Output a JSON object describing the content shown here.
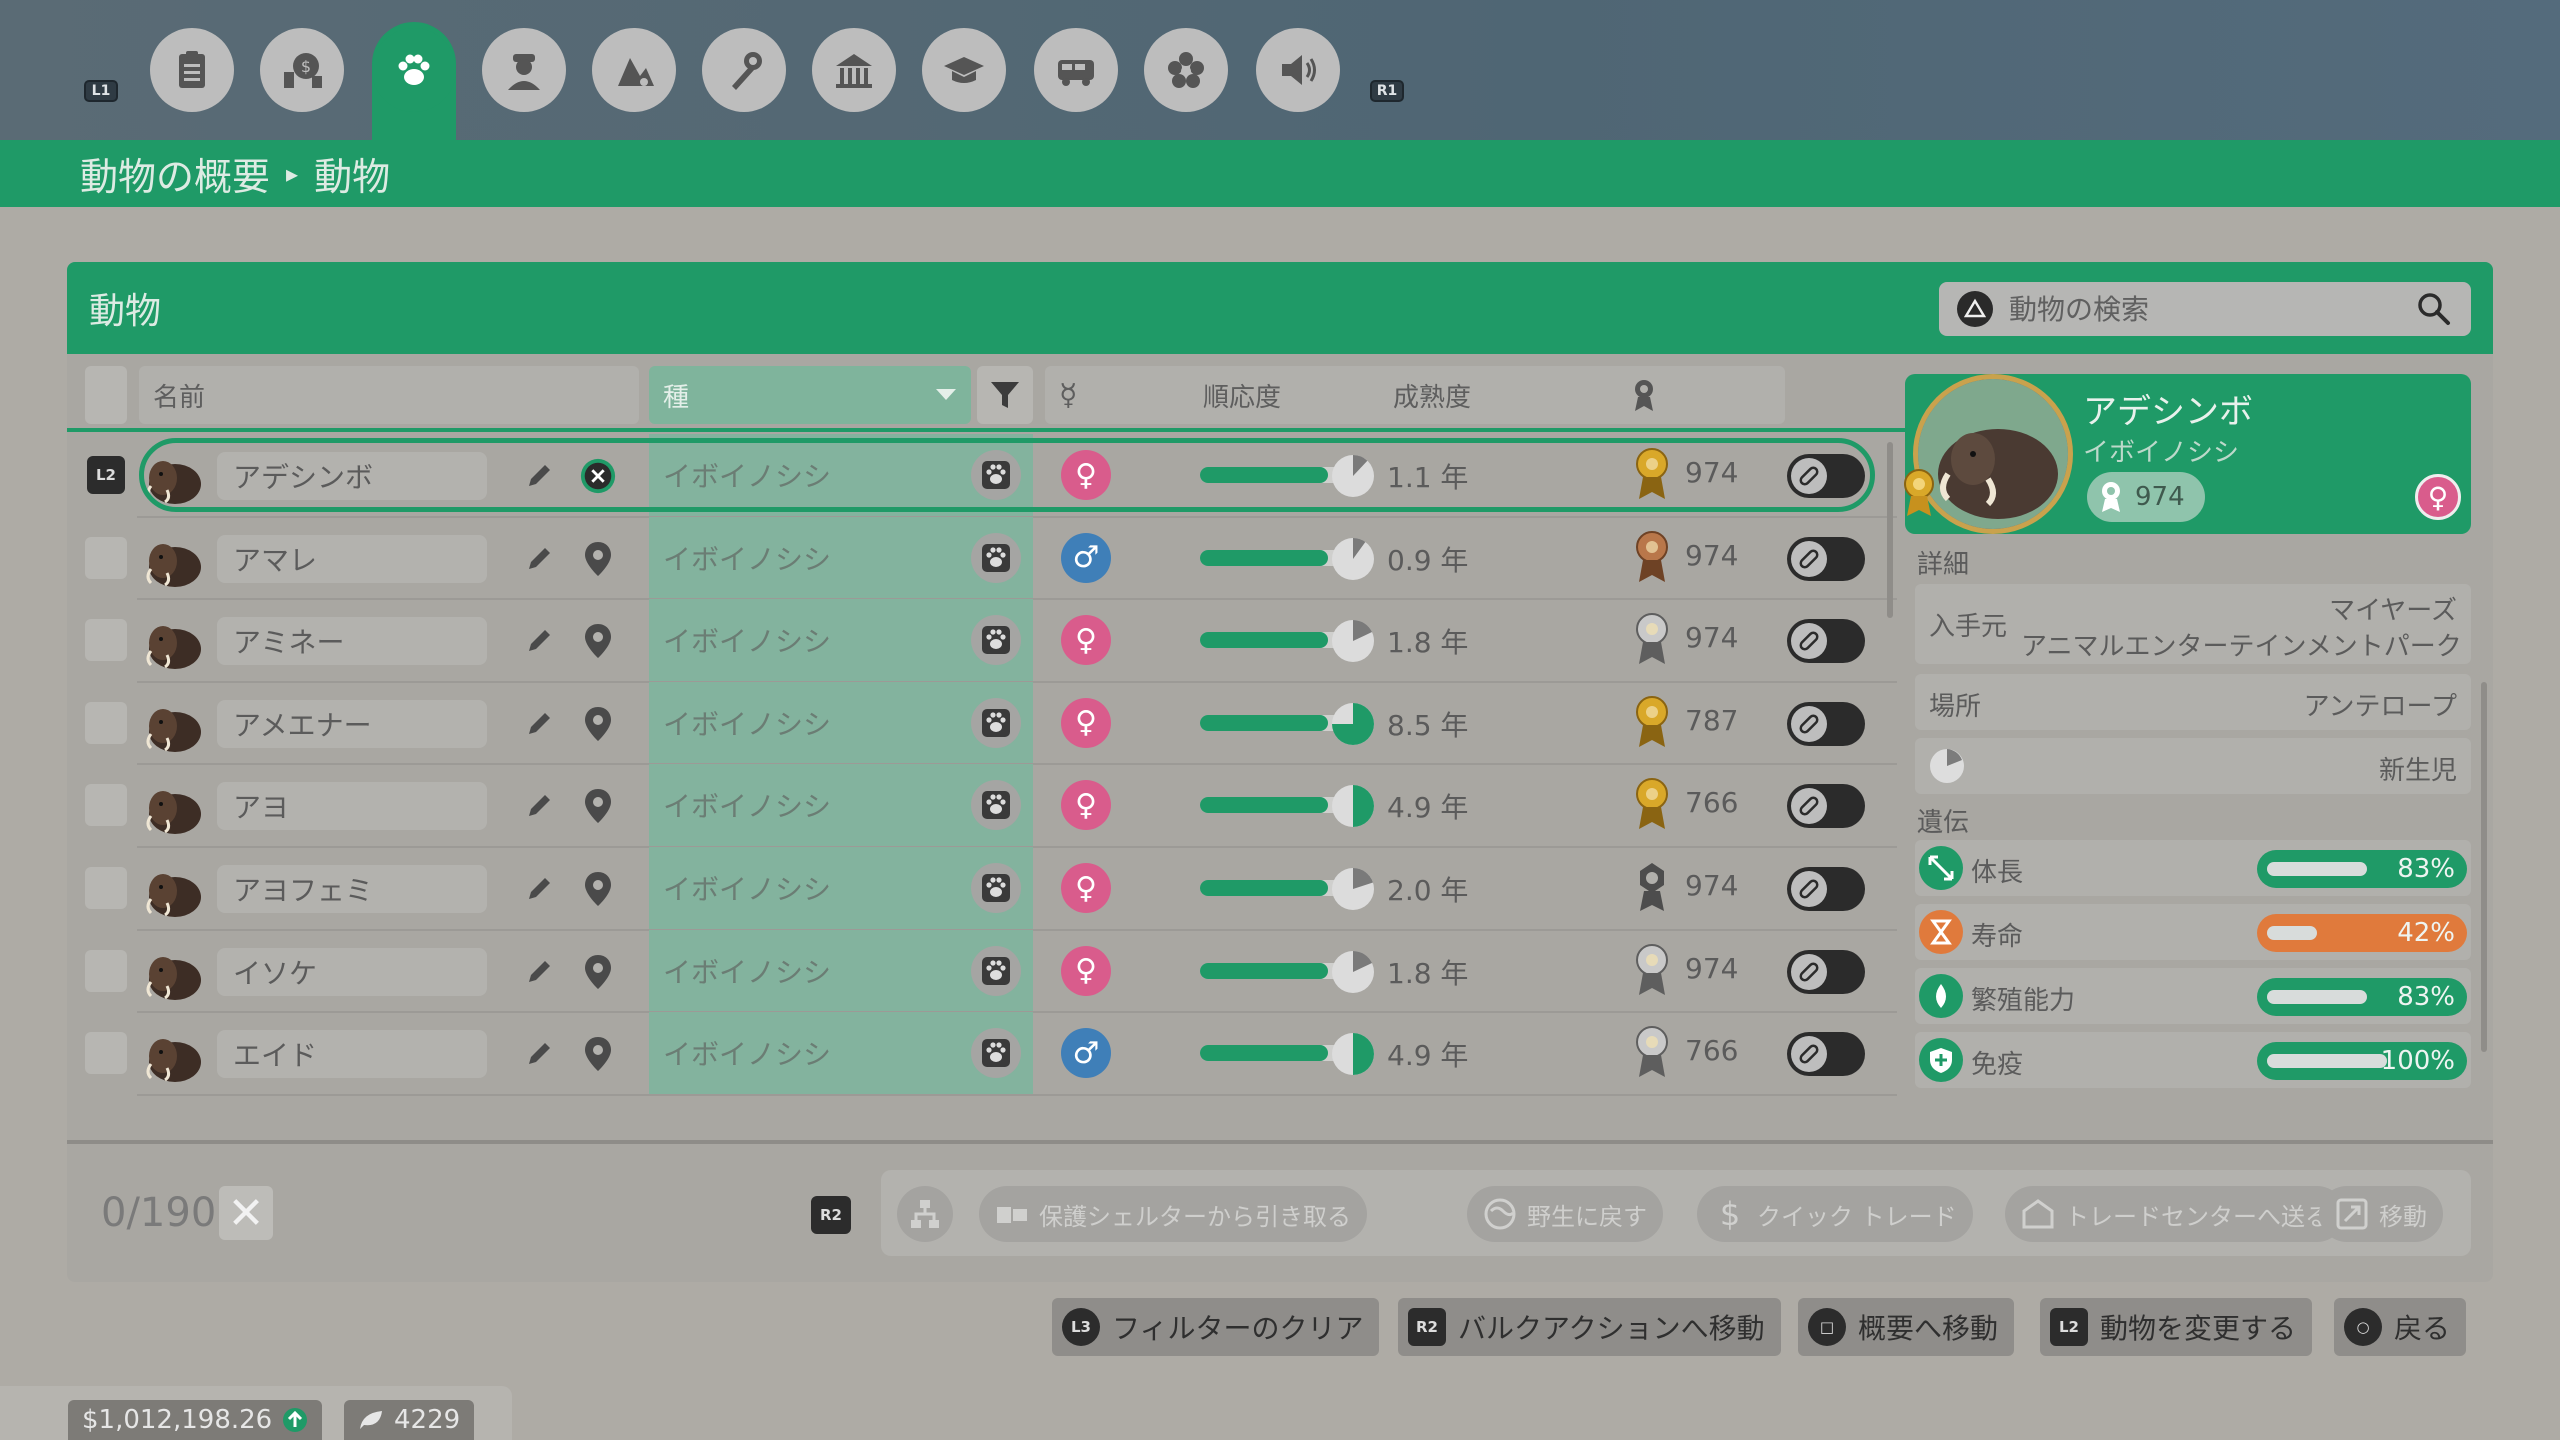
{
  "nav": {
    "left_shoulder": "L1",
    "right_shoulder": "R1",
    "tabs": [
      {
        "icon": "clipboard-icon"
      },
      {
        "icon": "finance-icon"
      },
      {
        "icon": "animal-paw-icon",
        "active": true
      },
      {
        "icon": "staff-icon"
      },
      {
        "icon": "habitat-icon"
      },
      {
        "icon": "maintenance-icon"
      },
      {
        "icon": "facilities-icon"
      },
      {
        "icon": "education-icon"
      },
      {
        "icon": "transport-icon"
      },
      {
        "icon": "flower-icon"
      },
      {
        "icon": "speaker-icon"
      }
    ]
  },
  "breadcrumb": {
    "root": "動物の概要",
    "separator": "▸",
    "current": "動物"
  },
  "panel": {
    "title": "動物"
  },
  "search": {
    "placeholder": "動物の検索"
  },
  "columns": {
    "name": "名前",
    "species": "種",
    "sex": "☿",
    "adaptation": "順応度",
    "maturity": "成熟度"
  },
  "rows": [
    {
      "name": "アデシンボ",
      "species": "イボイノシシ",
      "sex": "female",
      "sex_symbol": "♀",
      "adaptation": 0.88,
      "age": "1.1 年",
      "age_fraction": 0.12,
      "medal": "gold",
      "score": "974",
      "selected": true,
      "badge": "L2"
    },
    {
      "name": "アマレ",
      "species": "イボイノシシ",
      "sex": "male",
      "sex_symbol": "♂",
      "adaptation": 0.88,
      "age": "0.9 年",
      "age_fraction": 0.1,
      "medal": "bronze",
      "score": "974"
    },
    {
      "name": "アミネー",
      "species": "イボイノシシ",
      "sex": "female",
      "sex_symbol": "♀",
      "adaptation": 0.88,
      "age": "1.8 年",
      "age_fraction": 0.18,
      "medal": "silver",
      "score": "974"
    },
    {
      "name": "アメエナー",
      "species": "イボイノシシ",
      "sex": "female",
      "sex_symbol": "♀",
      "adaptation": 0.88,
      "age": "8.5 年",
      "age_fraction": 0.75,
      "medal": "gold",
      "score": "787"
    },
    {
      "name": "アヨ",
      "species": "イボイノシシ",
      "sex": "female",
      "sex_symbol": "♀",
      "adaptation": 0.88,
      "age": "4.9 年",
      "age_fraction": 0.5,
      "medal": "gold",
      "score": "766"
    },
    {
      "name": "アヨフェミ",
      "species": "イボイノシシ",
      "sex": "female",
      "sex_symbol": "♀",
      "adaptation": 0.88,
      "age": "2.0 年",
      "age_fraction": 0.2,
      "medal": "none",
      "score": "974"
    },
    {
      "name": "イソケ",
      "species": "イボイノシシ",
      "sex": "female",
      "sex_symbol": "♀",
      "adaptation": 0.88,
      "age": "1.8 年",
      "age_fraction": 0.18,
      "medal": "silver",
      "score": "974"
    },
    {
      "name": "エイド",
      "species": "イボイノシシ",
      "sex": "male",
      "sex_symbol": "♂",
      "adaptation": 0.88,
      "age": "4.9 年",
      "age_fraction": 0.5,
      "medal": "silver",
      "score": "766"
    }
  ],
  "detail": {
    "name": "アデシンボ",
    "species": "イボイノシシ",
    "score": "974",
    "sex_symbol": "♀",
    "section_details": "詳細",
    "origin_label": "入手元",
    "origin_value_1": "マイヤーズ",
    "origin_value_2": "アニマルエンターテインメントパーク",
    "location_label": "場所",
    "location_value": "アンテロープ",
    "stage_value": "新生児",
    "section_genetics": "遺伝",
    "genes": [
      {
        "label": "体長",
        "percent": "83%",
        "value": 0.83,
        "color": "#1f9a67",
        "icon": "size-icon"
      },
      {
        "label": "寿命",
        "percent": "42%",
        "value": 0.42,
        "color": "#e07a3c",
        "icon": "hourglass-icon"
      },
      {
        "label": "繁殖能力",
        "percent": "83%",
        "value": 0.83,
        "color": "#1f9a67",
        "icon": "fertility-icon"
      },
      {
        "label": "免疫",
        "percent": "100%",
        "value": 1.0,
        "color": "#1f9a67",
        "icon": "immunity-icon"
      }
    ]
  },
  "bulk": {
    "count": "0/190",
    "clear_symbol": "✕",
    "badge": "R2",
    "actions": [
      {
        "label": "保護シェルターから引き取る"
      },
      {
        "label": "野生に戻す"
      },
      {
        "label": "クイック トレード"
      },
      {
        "label": "トレードセンターへ送る"
      },
      {
        "label": "移動"
      }
    ]
  },
  "hints": [
    {
      "badge": "L3",
      "label": "フィルターのクリア"
    },
    {
      "badge": "R2",
      "label": "バルクアクションへ移動"
    },
    {
      "badge": "□",
      "label": "概要へ移動"
    },
    {
      "badge": "L2",
      "label": "動物を変更する"
    },
    {
      "badge": "○",
      "label": "戻る"
    }
  ],
  "footer": {
    "money": "$1,012,198.26",
    "conservation": "4229"
  }
}
